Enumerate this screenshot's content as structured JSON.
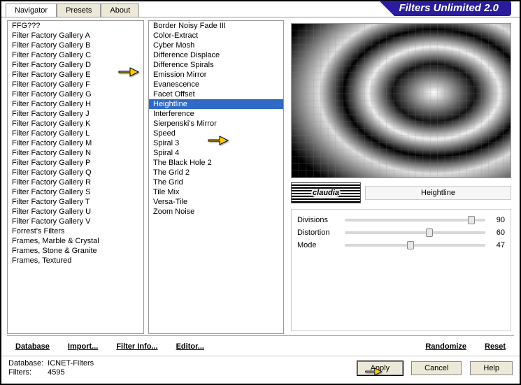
{
  "tabs": [
    "Navigator",
    "Presets",
    "About"
  ],
  "activeTab": 0,
  "windowTitle": "Filters Unlimited 2.0",
  "categories": [
    "FFG???",
    "Filter Factory Gallery A",
    "Filter Factory Gallery B",
    "Filter Factory Gallery C",
    "Filter Factory Gallery D",
    "Filter Factory Gallery E",
    "Filter Factory Gallery F",
    "Filter Factory Gallery G",
    "Filter Factory Gallery H",
    "Filter Factory Gallery J",
    "Filter Factory Gallery K",
    "Filter Factory Gallery L",
    "Filter Factory Gallery M",
    "Filter Factory Gallery N",
    "Filter Factory Gallery P",
    "Filter Factory Gallery Q",
    "Filter Factory Gallery R",
    "Filter Factory Gallery S",
    "Filter Factory Gallery T",
    "Filter Factory Gallery U",
    "Filter Factory Gallery V",
    "Forrest's Filters",
    "Frames, Marble & Crystal",
    "Frames, Stone & Granite",
    "Frames, Textured"
  ],
  "selectedCategoryIndex": 3,
  "filters": [
    "Border Noisy Fade III",
    "Color-Extract",
    "Cyber Mosh",
    "Difference Displace",
    "Difference Spirals",
    "Emission Mirror",
    "Evanescence",
    "Facet Offset",
    "Heightline",
    "Interference",
    "Sierpenski's Mirror",
    "Speed",
    "Spiral 3",
    "Spiral 4",
    "The Black Hole 2",
    "The Grid 2",
    "The Grid",
    "Tile Mix",
    "Versa-Tile",
    "Zoom Noise"
  ],
  "selectedFilterIndex": 8,
  "currentFilterName": "Heightline",
  "claudiaLabel": "claudia",
  "sliders": [
    {
      "label": "Divisions",
      "value": 90,
      "max": 100
    },
    {
      "label": "Distortion",
      "value": 60,
      "max": 100
    },
    {
      "label": "Mode",
      "value": 47,
      "max": 100
    }
  ],
  "btns": {
    "database": "Database",
    "import": "Import...",
    "filterInfo": "Filter Info...",
    "editor": "Editor...",
    "randomize": "Randomize",
    "reset": "Reset",
    "apply": "Apply",
    "cancel": "Cancel",
    "help": "Help"
  },
  "status": {
    "dbLabel": "Database:",
    "dbValue": "ICNET-Filters",
    "filtersLabel": "Filters:",
    "filtersValue": "4595"
  }
}
